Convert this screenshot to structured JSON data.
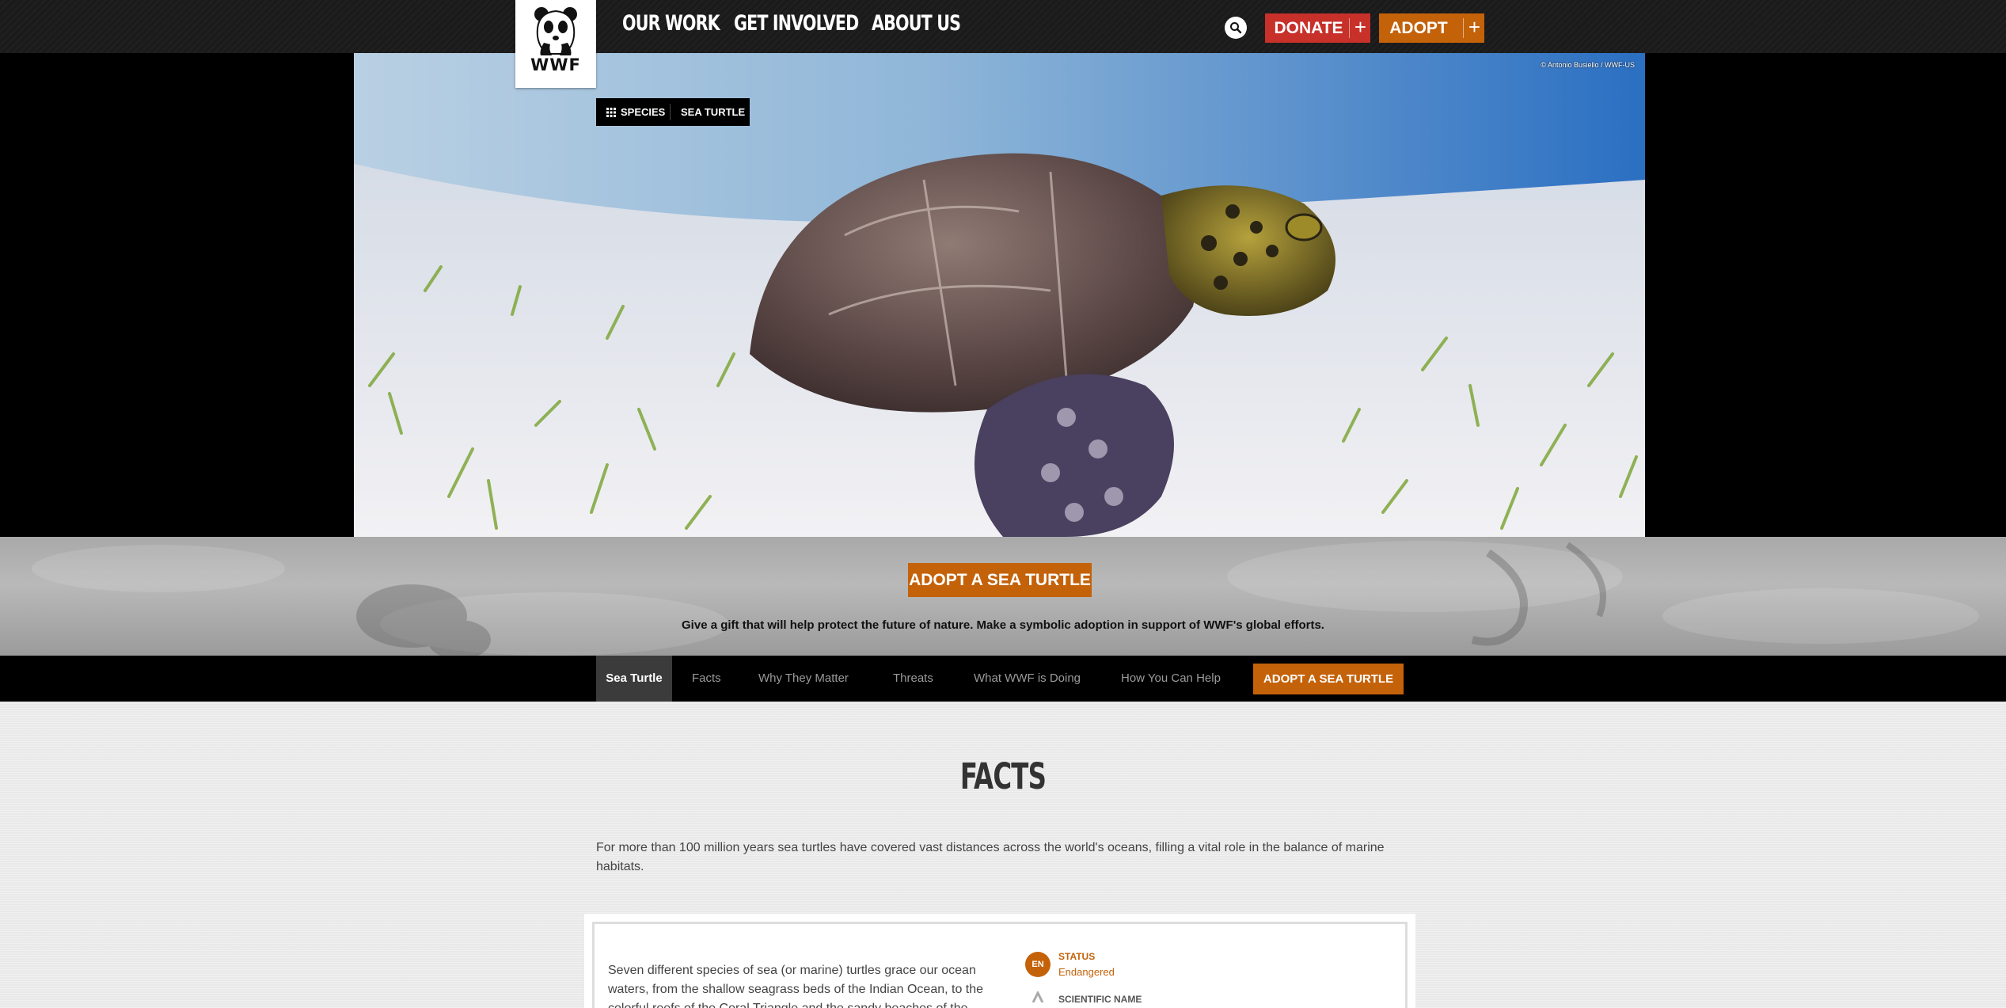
{
  "brand": {
    "logo_text": "WWF"
  },
  "nav": {
    "items": [
      "OUR WORK",
      "GET INVOLVED",
      "ABOUT US"
    ],
    "donate_label": "DONATE",
    "adopt_label": "ADOPT",
    "plus": "+"
  },
  "hero": {
    "photo_credit": "© Antonio Busiello / WWF-US",
    "breadcrumb": {
      "section": "SPECIES",
      "current": "SEA TURTLE"
    }
  },
  "adopt_band": {
    "button_label": "ADOPT A SEA TURTLE",
    "text": "Give a gift that will help protect the future of nature. Make a symbolic adoption in support of WWF's global efforts."
  },
  "subnav": {
    "items": [
      "Sea Turtle",
      "Facts",
      "Why They Matter",
      "Threats",
      "What WWF is Doing",
      "How You Can Help"
    ],
    "active_index": 0,
    "adopt_label": "ADOPT A SEA TURTLE"
  },
  "facts": {
    "title": "FACTS",
    "intro": "For more than 100 million years sea turtles have covered vast distances across the world's oceans, filling a vital role in the balance of marine habitats.",
    "body": "Seven different species of sea (or marine) turtles grace our ocean waters, from the shallow seagrass beds of the Indian Ocean, to the colorful reefs of the Coral Triangle and the sandy beaches of the",
    "status": {
      "badge": "EN",
      "label": "STATUS",
      "value": "Endangered"
    },
    "scientific_name_label": "SCIENTIFIC NAME"
  },
  "colors": {
    "accent_orange": "#c4620a",
    "donate_red": "#c8302a",
    "nav_bg": "#1a1a1a"
  }
}
